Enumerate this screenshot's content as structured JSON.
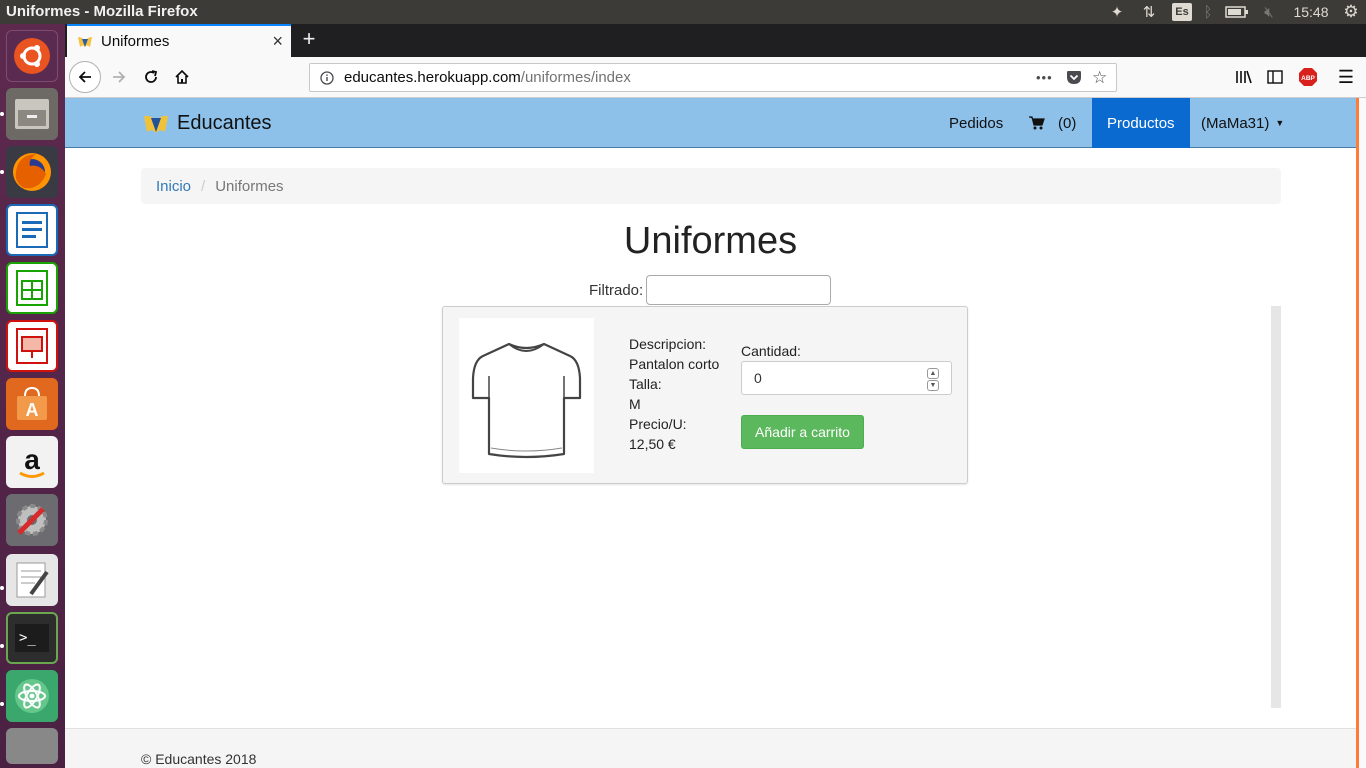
{
  "window": {
    "title": "Uniformes - Mozilla Firefox"
  },
  "system": {
    "keyboard": "Es",
    "clock": "15:48"
  },
  "launcher": {
    "items": [
      "ubuntu-dash",
      "files",
      "firefox",
      "libreoffice-writer",
      "libreoffice-calc",
      "libreoffice-impress",
      "ubuntu-software",
      "amazon",
      "system-settings",
      "text-editor",
      "terminal",
      "atom"
    ]
  },
  "browser": {
    "tab_title": "Uniformes",
    "tab_close": "×",
    "newtab": "+",
    "url_host": "educantes.herokuapp.com",
    "url_path": "/uniformes/index",
    "more": "•••",
    "abp": "ABP",
    "menu": "☰"
  },
  "app": {
    "brand": "Educantes",
    "nav": {
      "pedidos": "Pedidos",
      "cart_count": "(0)",
      "productos": "Productos",
      "user": "(MaMa31)"
    },
    "breadcrumb": {
      "home": "Inicio",
      "sep": "/",
      "current": "Uniformes"
    },
    "heading": "Uniformes",
    "filter": {
      "label": "Filtrado:",
      "value": ""
    },
    "product": {
      "desc_label": "Descripcion:",
      "desc_value": "Pantalon corto",
      "size_label": "Talla:",
      "size_value": "M",
      "price_label": "Precio/U:",
      "price_value": "12,50 €",
      "qty_label": "Cantidad:",
      "qty_value": "0",
      "add_button": "Añadir a carrito"
    },
    "footer": "© Educantes 2018"
  }
}
